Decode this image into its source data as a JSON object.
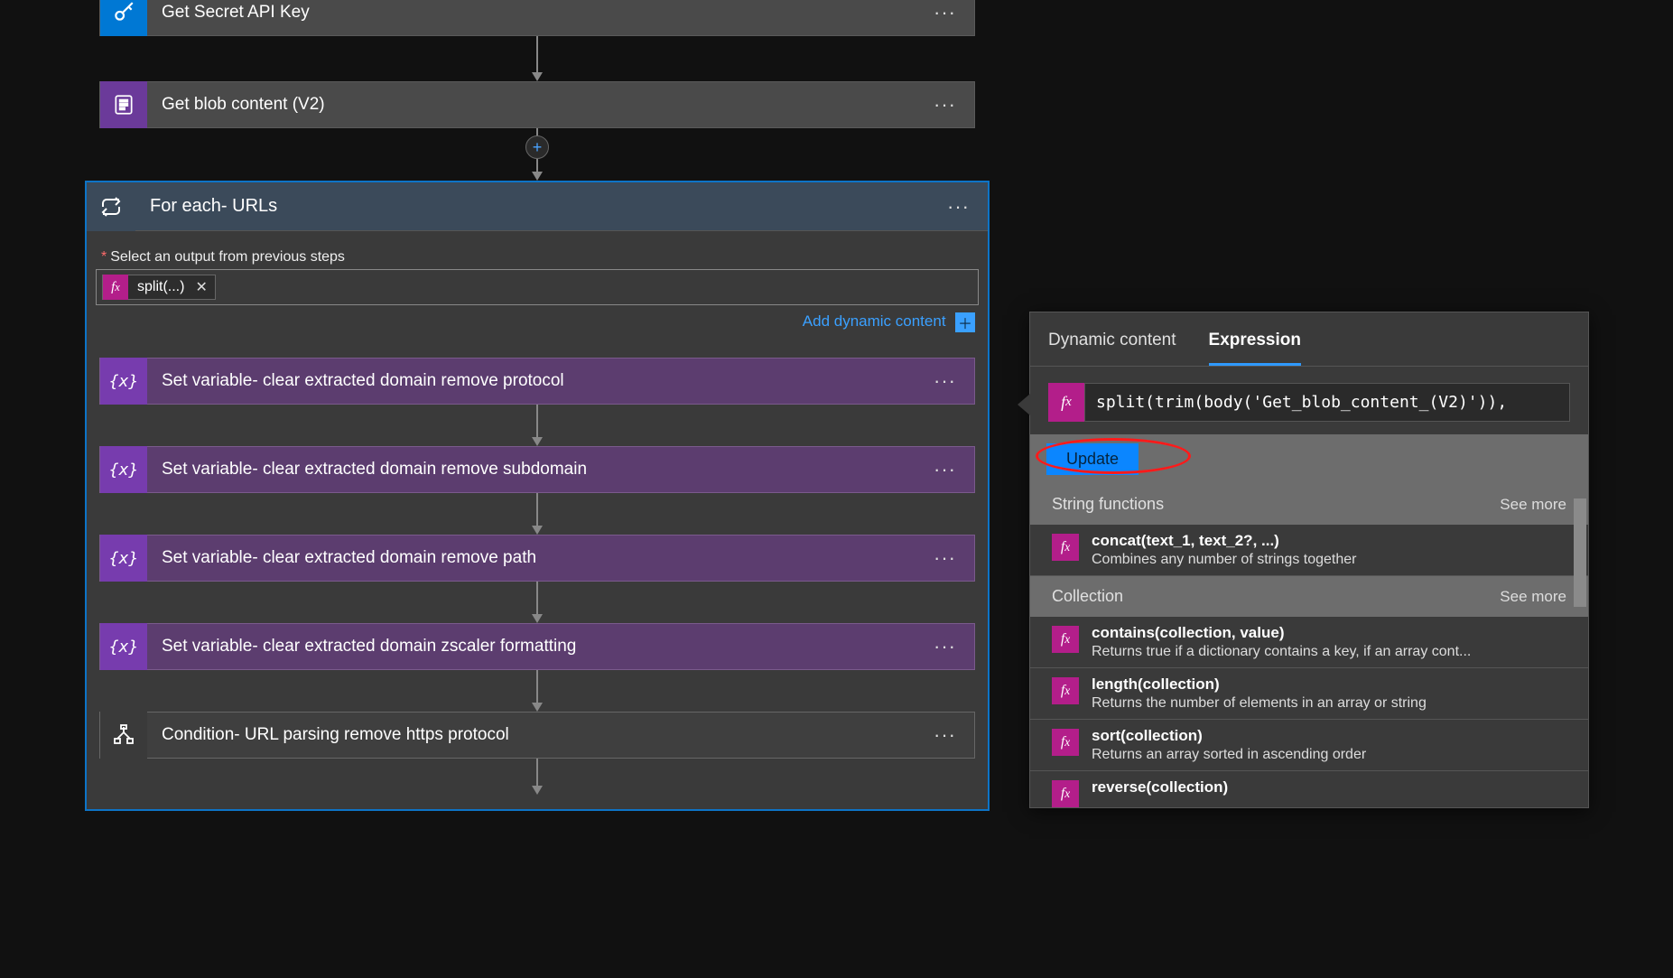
{
  "workflow": {
    "steps": [
      {
        "icon": "key-icon",
        "iconBg": "bg-blue",
        "label": "Get Secret API Key"
      },
      {
        "icon": "blob-icon",
        "iconBg": "bg-purple",
        "label": "Get blob content (V2)"
      }
    ],
    "foreach": {
      "title": "For each- URLs",
      "fieldLabel": "Select an output from previous steps",
      "token": "split(...)",
      "addDynamic": "Add dynamic content",
      "inner": [
        {
          "type": "var",
          "label": "Set variable- clear extracted domain remove protocol"
        },
        {
          "type": "var",
          "label": "Set variable- clear extracted domain remove subdomain"
        },
        {
          "type": "var",
          "label": "Set variable- clear extracted domain remove path"
        },
        {
          "type": "var",
          "label": "Set variable- clear extracted domain zscaler formatting"
        },
        {
          "type": "cond",
          "label": "Condition- URL parsing remove https protocol"
        }
      ]
    }
  },
  "panel": {
    "tabs": {
      "dynamic": "Dynamic content",
      "expression": "Expression"
    },
    "expression": "split(trim(body('Get_blob_content_(V2)')),",
    "updateLabel": "Update",
    "cats": [
      {
        "name": "String functions",
        "seeMore": "See more",
        "items": [
          {
            "sig": "concat(text_1, text_2?, ...)",
            "desc": "Combines any number of strings together"
          }
        ]
      },
      {
        "name": "Collection",
        "seeMore": "See more",
        "items": [
          {
            "sig": "contains(collection, value)",
            "desc": "Returns true if a dictionary contains a key, if an array cont..."
          },
          {
            "sig": "length(collection)",
            "desc": "Returns the number of elements in an array or string"
          },
          {
            "sig": "sort(collection)",
            "desc": "Returns an array sorted in ascending order"
          },
          {
            "sig": "reverse(collection)",
            "desc": ""
          }
        ]
      }
    ]
  }
}
